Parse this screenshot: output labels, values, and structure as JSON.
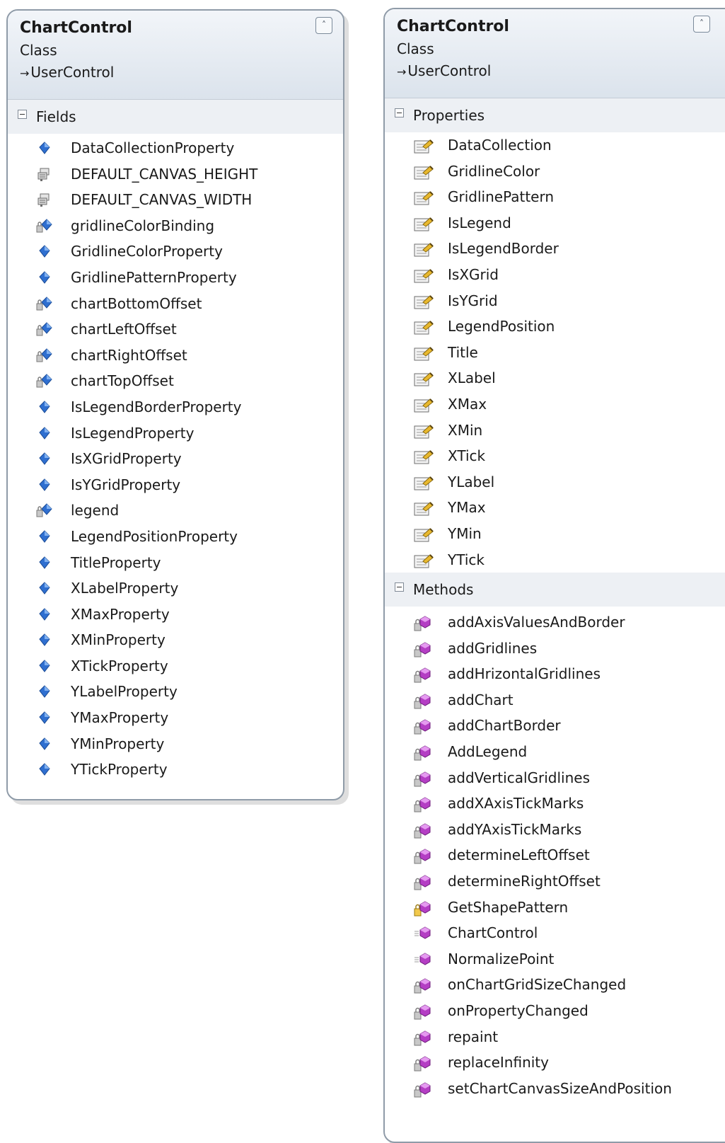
{
  "left_panel": {
    "title": "ChartControl",
    "kind": "Class",
    "base": "UserControl",
    "base_arrow": "→",
    "collapse_glyph": "˄",
    "sections": {
      "fields": {
        "label": "Fields",
        "items": [
          {
            "label": "DataCollectionProperty",
            "icon": "public-field-icon"
          },
          {
            "label": "DEFAULT_CANVAS_HEIGHT",
            "icon": "constant-icon"
          },
          {
            "label": "DEFAULT_CANVAS_WIDTH",
            "icon": "constant-icon"
          },
          {
            "label": "gridlineColorBinding",
            "icon": "private-field-icon"
          },
          {
            "label": "GridlineColorProperty",
            "icon": "public-field-icon"
          },
          {
            "label": "GridlinePatternProperty",
            "icon": "public-field-icon"
          },
          {
            "label": "chartBottomOffset",
            "icon": "private-field-icon"
          },
          {
            "label": "chartLeftOffset",
            "icon": "private-field-icon"
          },
          {
            "label": "chartRightOffset",
            "icon": "private-field-icon"
          },
          {
            "label": "chartTopOffset",
            "icon": "private-field-icon"
          },
          {
            "label": "IsLegendBorderProperty",
            "icon": "public-field-icon"
          },
          {
            "label": "IsLegendProperty",
            "icon": "public-field-icon"
          },
          {
            "label": "IsXGridProperty",
            "icon": "public-field-icon"
          },
          {
            "label": "IsYGridProperty",
            "icon": "public-field-icon"
          },
          {
            "label": "legend",
            "icon": "private-field-icon"
          },
          {
            "label": "LegendPositionProperty",
            "icon": "public-field-icon"
          },
          {
            "label": "TitleProperty",
            "icon": "public-field-icon"
          },
          {
            "label": "XLabelProperty",
            "icon": "public-field-icon"
          },
          {
            "label": "XMaxProperty",
            "icon": "public-field-icon"
          },
          {
            "label": "XMinProperty",
            "icon": "public-field-icon"
          },
          {
            "label": "XTickProperty",
            "icon": "public-field-icon"
          },
          {
            "label": "YLabelProperty",
            "icon": "public-field-icon"
          },
          {
            "label": "YMaxProperty",
            "icon": "public-field-icon"
          },
          {
            "label": "YMinProperty",
            "icon": "public-field-icon"
          },
          {
            "label": "YTickProperty",
            "icon": "public-field-icon"
          }
        ]
      }
    }
  },
  "right_panel": {
    "title": "ChartControl",
    "kind": "Class",
    "base": "UserControl",
    "base_arrow": "→",
    "collapse_glyph": "˄",
    "sections": {
      "properties": {
        "label": "Properties",
        "items": [
          {
            "label": "DataCollection",
            "icon": "property-icon"
          },
          {
            "label": "GridlineColor",
            "icon": "property-icon"
          },
          {
            "label": "GridlinePattern",
            "icon": "property-icon"
          },
          {
            "label": "IsLegend",
            "icon": "property-icon"
          },
          {
            "label": "IsLegendBorder",
            "icon": "property-icon"
          },
          {
            "label": "IsXGrid",
            "icon": "property-icon"
          },
          {
            "label": "IsYGrid",
            "icon": "property-icon"
          },
          {
            "label": "LegendPosition",
            "icon": "property-icon"
          },
          {
            "label": "Title",
            "icon": "property-icon"
          },
          {
            "label": "XLabel",
            "icon": "property-icon"
          },
          {
            "label": "XMax",
            "icon": "property-icon"
          },
          {
            "label": "XMin",
            "icon": "property-icon"
          },
          {
            "label": "XTick",
            "icon": "property-icon"
          },
          {
            "label": "YLabel",
            "icon": "property-icon"
          },
          {
            "label": "YMax",
            "icon": "property-icon"
          },
          {
            "label": "YMin",
            "icon": "property-icon"
          },
          {
            "label": "YTick",
            "icon": "property-icon"
          }
        ]
      },
      "methods": {
        "label": "Methods",
        "items": [
          {
            "label": "addAxisValuesAndBorder",
            "icon": "private-method-icon"
          },
          {
            "label": "addGridlines",
            "icon": "private-method-icon"
          },
          {
            "label": "addHrizontalGridlines",
            "icon": "private-method-icon"
          },
          {
            "label": "addChart",
            "icon": "private-method-icon"
          },
          {
            "label": "addChartBorder",
            "icon": "private-method-icon"
          },
          {
            "label": "AddLegend",
            "icon": "private-method-icon"
          },
          {
            "label": "addVerticalGridlines",
            "icon": "private-method-icon"
          },
          {
            "label": "addXAxisTickMarks",
            "icon": "private-method-icon"
          },
          {
            "label": "addYAxisTickMarks",
            "icon": "private-method-icon"
          },
          {
            "label": "determineLeftOffset",
            "icon": "private-method-icon"
          },
          {
            "label": "determineRightOffset",
            "icon": "private-method-icon"
          },
          {
            "label": "GetShapePattern",
            "icon": "protected-method-icon"
          },
          {
            "label": "ChartControl",
            "icon": "public-method-icon"
          },
          {
            "label": "NormalizePoint",
            "icon": "public-method-icon"
          },
          {
            "label": "onChartGridSizeChanged",
            "icon": "private-method-icon"
          },
          {
            "label": "onPropertyChanged",
            "icon": "private-method-icon"
          },
          {
            "label": "repaint",
            "icon": "private-method-icon"
          },
          {
            "label": "replaceInfinity",
            "icon": "private-method-icon"
          },
          {
            "label": "setChartCanvasSizeAndPosition",
            "icon": "private-method-icon"
          }
        ]
      }
    }
  }
}
